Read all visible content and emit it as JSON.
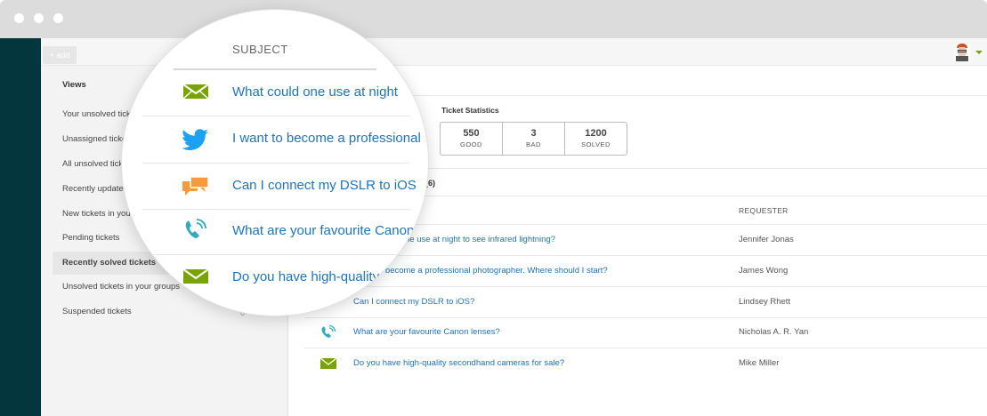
{
  "toolbar": {
    "add_label": "+ add"
  },
  "views": {
    "title": "Views",
    "items": [
      {
        "label": "Your unsolved tickets",
        "count": ""
      },
      {
        "label": "Unassigned tickets",
        "count": ""
      },
      {
        "label": "All unsolved tickets",
        "count": ""
      },
      {
        "label": "Recently updated tickets",
        "count": ""
      },
      {
        "label": "New tickets in your groups",
        "count": ""
      },
      {
        "label": "Pending tickets",
        "count": ""
      },
      {
        "label": "Recently solved tickets",
        "count": ""
      },
      {
        "label": "Unsolved tickets in your groups",
        "count": ""
      },
      {
        "label": "Suspended tickets",
        "count": "0"
      }
    ]
  },
  "stats": {
    "title": "Ticket Statistics",
    "good": {
      "value": "550",
      "label": "GOOD"
    },
    "bad": {
      "value": "3",
      "label": "BAD"
    },
    "solved": {
      "value": "1200",
      "label": "SOLVED"
    }
  },
  "list": {
    "title": "n (6)",
    "columns": {
      "subject": "SUBJECT",
      "requester": "REQUESTER"
    },
    "rows": [
      {
        "icon": "email-icon",
        "subject": "What could one use at night to see infrared lightning?",
        "requester": "Jennifer Jonas"
      },
      {
        "icon": "twitter-icon",
        "subject": "I want to become a professional photographer. Where should I start?",
        "requester": "James Wong"
      },
      {
        "icon": "chat-icon",
        "subject": "Can I connect my DSLR to iOS?",
        "requester": "Lindsey Rhett"
      },
      {
        "icon": "phone-icon",
        "subject": "What are your favourite Canon lenses?",
        "requester": "Nicholas A. R. Yan"
      },
      {
        "icon": "email-icon",
        "subject": "Do you have high-quality secondhand cameras for sale?",
        "requester": "Mike Miller"
      }
    ],
    "visible": {
      "row0": "he use at night to see infrared lightning?",
      "row1": "o become a professional photographer. Where should I start?",
      "row2": "Can I connect my DSLR to iOS?",
      "row3": "What are your favourite Canon lenses?",
      "row4": "Do you have high-quality secondhand cameras for sale?"
    }
  },
  "magnifier": {
    "header": "SUBJECT",
    "rows": [
      "What could one use at night",
      "I want to become a professional",
      "Can I connect my DSLR to iOS",
      "What are your favourite Canon",
      "Do you have high-quality"
    ]
  },
  "colors": {
    "nav": "#03363d",
    "link": "#1f73b7",
    "email": "#78a300",
    "twitter": "#1da1f2",
    "chat": "#f79a3e",
    "phone": "#30aabc"
  }
}
